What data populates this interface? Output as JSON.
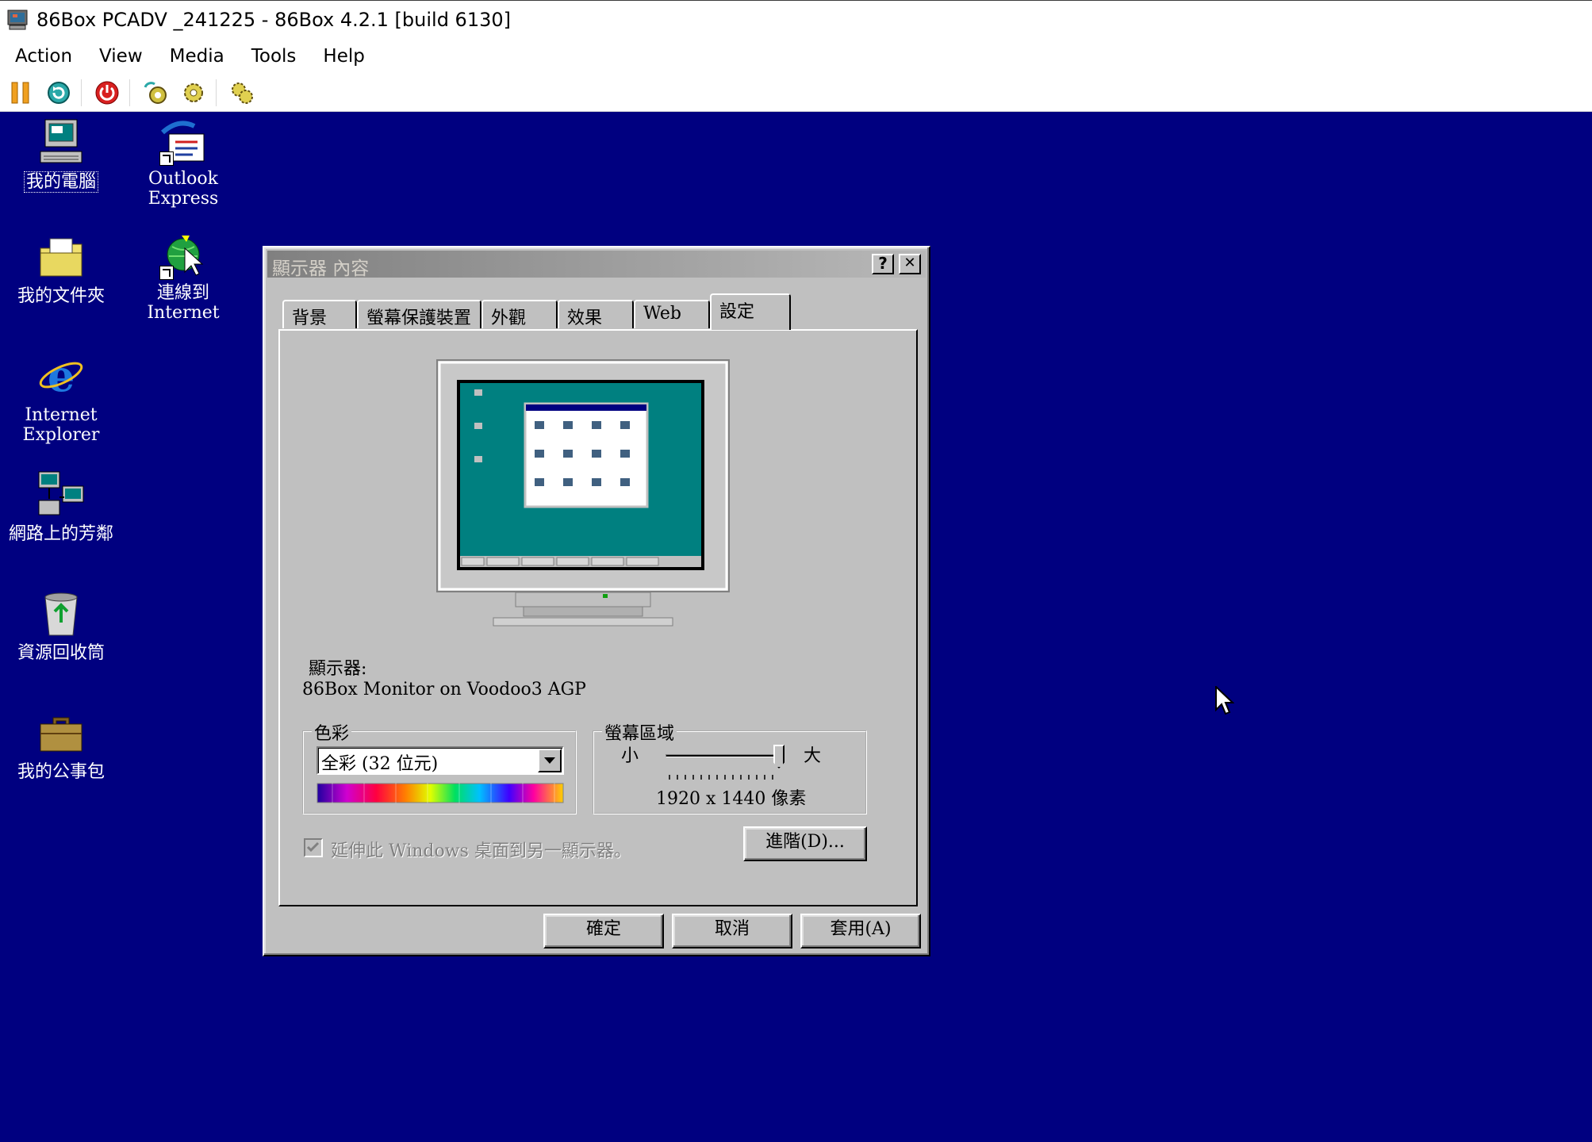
{
  "window": {
    "title": "86Box PCADV _241225 - 86Box 4.2.1 [build 6130]"
  },
  "menu": [
    "Action",
    "View",
    "Media",
    "Tools",
    "Help"
  ],
  "toolbar": [
    "pause-icon",
    "reset-icon",
    "power-icon",
    "settings-icon",
    "settings2-icon",
    "settings3-icon"
  ],
  "desktop": {
    "icons": {
      "my_computer": "我的電腦",
      "outlook_1": "Outlook",
      "outlook_2": "Express",
      "my_documents": "我的文件夾",
      "connect_1": "連線到",
      "connect_2": "Internet",
      "ie_1": "Internet",
      "ie_2": "Explorer",
      "network": "網路上的芳鄰",
      "recycle": "資源回收筒",
      "briefcase": "我的公事包"
    }
  },
  "dialog": {
    "title": "顯示器 內容",
    "help_btn": "?",
    "close_btn": "✕",
    "tabs": [
      "背景",
      "螢幕保護裝置",
      "外觀",
      "效果",
      "Web",
      "設定"
    ],
    "active_tab": "設定",
    "display_label": "顯示器:",
    "display_value": "86Box Monitor on Voodoo3 AGP",
    "colors": {
      "legend": "色彩",
      "selected": "全彩 (32 位元)"
    },
    "screen_area": {
      "legend": "螢幕區域",
      "small": "小",
      "large": "大",
      "value": "1920 x 1440 像素",
      "slider_level": 1.0
    },
    "extend_checkbox": "延伸此 Windows 桌面到另一顯示器。",
    "advanced_btn": "進階(D)...",
    "ok_btn": "確定",
    "cancel_btn": "取消",
    "apply_btn": "套用(A)"
  },
  "colors": {
    "desktop": "#000080",
    "dialog": "#c0c0c0",
    "preview_screen": "#008080"
  }
}
